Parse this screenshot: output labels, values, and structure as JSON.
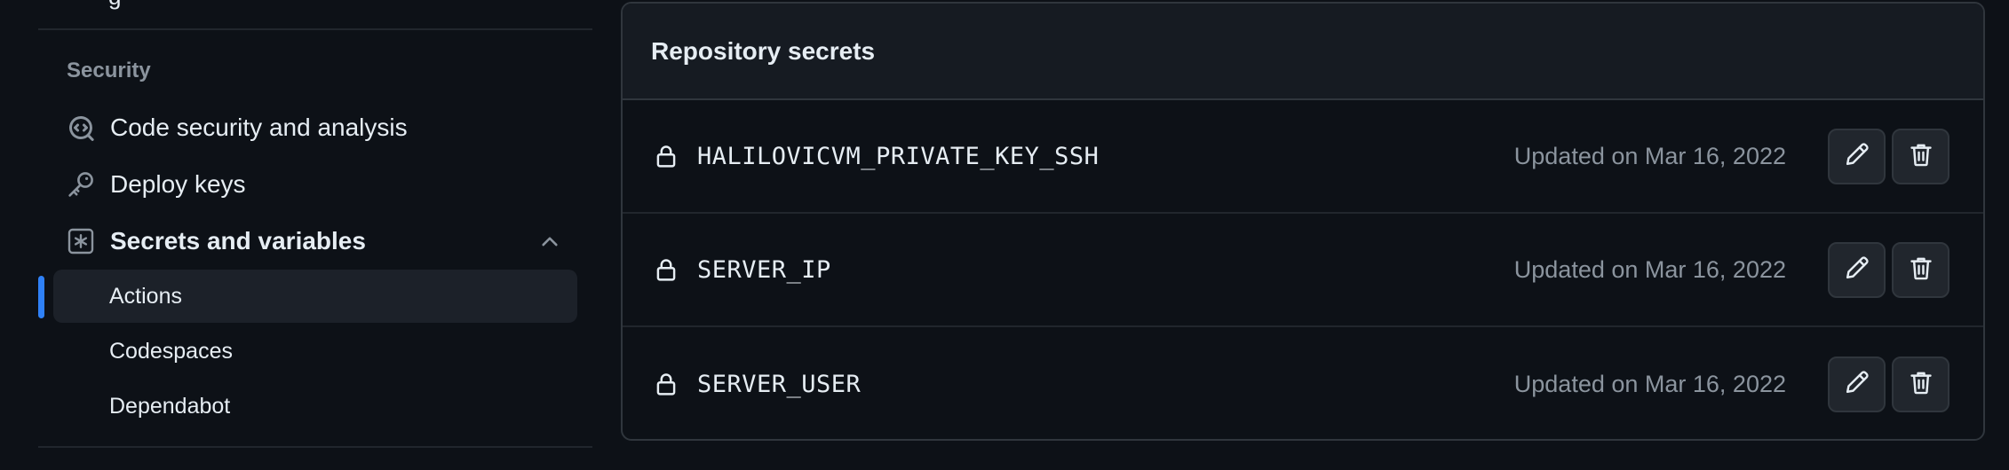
{
  "sidebar": {
    "cut_off_label": "g",
    "section_heading": "Security",
    "items": [
      {
        "label": "Code security and analysis",
        "icon": "codescan-icon"
      },
      {
        "label": "Deploy keys",
        "icon": "key-icon"
      },
      {
        "label": "Secrets and variables",
        "icon": "key-asterisk-icon",
        "expanded": true
      }
    ],
    "sub_items": [
      {
        "label": "Actions",
        "active": true
      },
      {
        "label": "Codespaces",
        "active": false
      },
      {
        "label": "Dependabot",
        "active": false
      }
    ]
  },
  "secrets_panel": {
    "title": "Repository secrets",
    "rows": [
      {
        "name": "HALILOVICVM_PRIVATE_KEY_SSH",
        "updated": "Updated on Mar 16, 2022"
      },
      {
        "name": "SERVER_IP",
        "updated": "Updated on Mar 16, 2022"
      },
      {
        "name": "SERVER_USER",
        "updated": "Updated on Mar 16, 2022"
      }
    ]
  },
  "colors": {
    "background": "#0d1117",
    "panel_header": "#161b22",
    "border": "#30363d",
    "muted_text": "#8b949e",
    "accent": "#2f81f7"
  }
}
